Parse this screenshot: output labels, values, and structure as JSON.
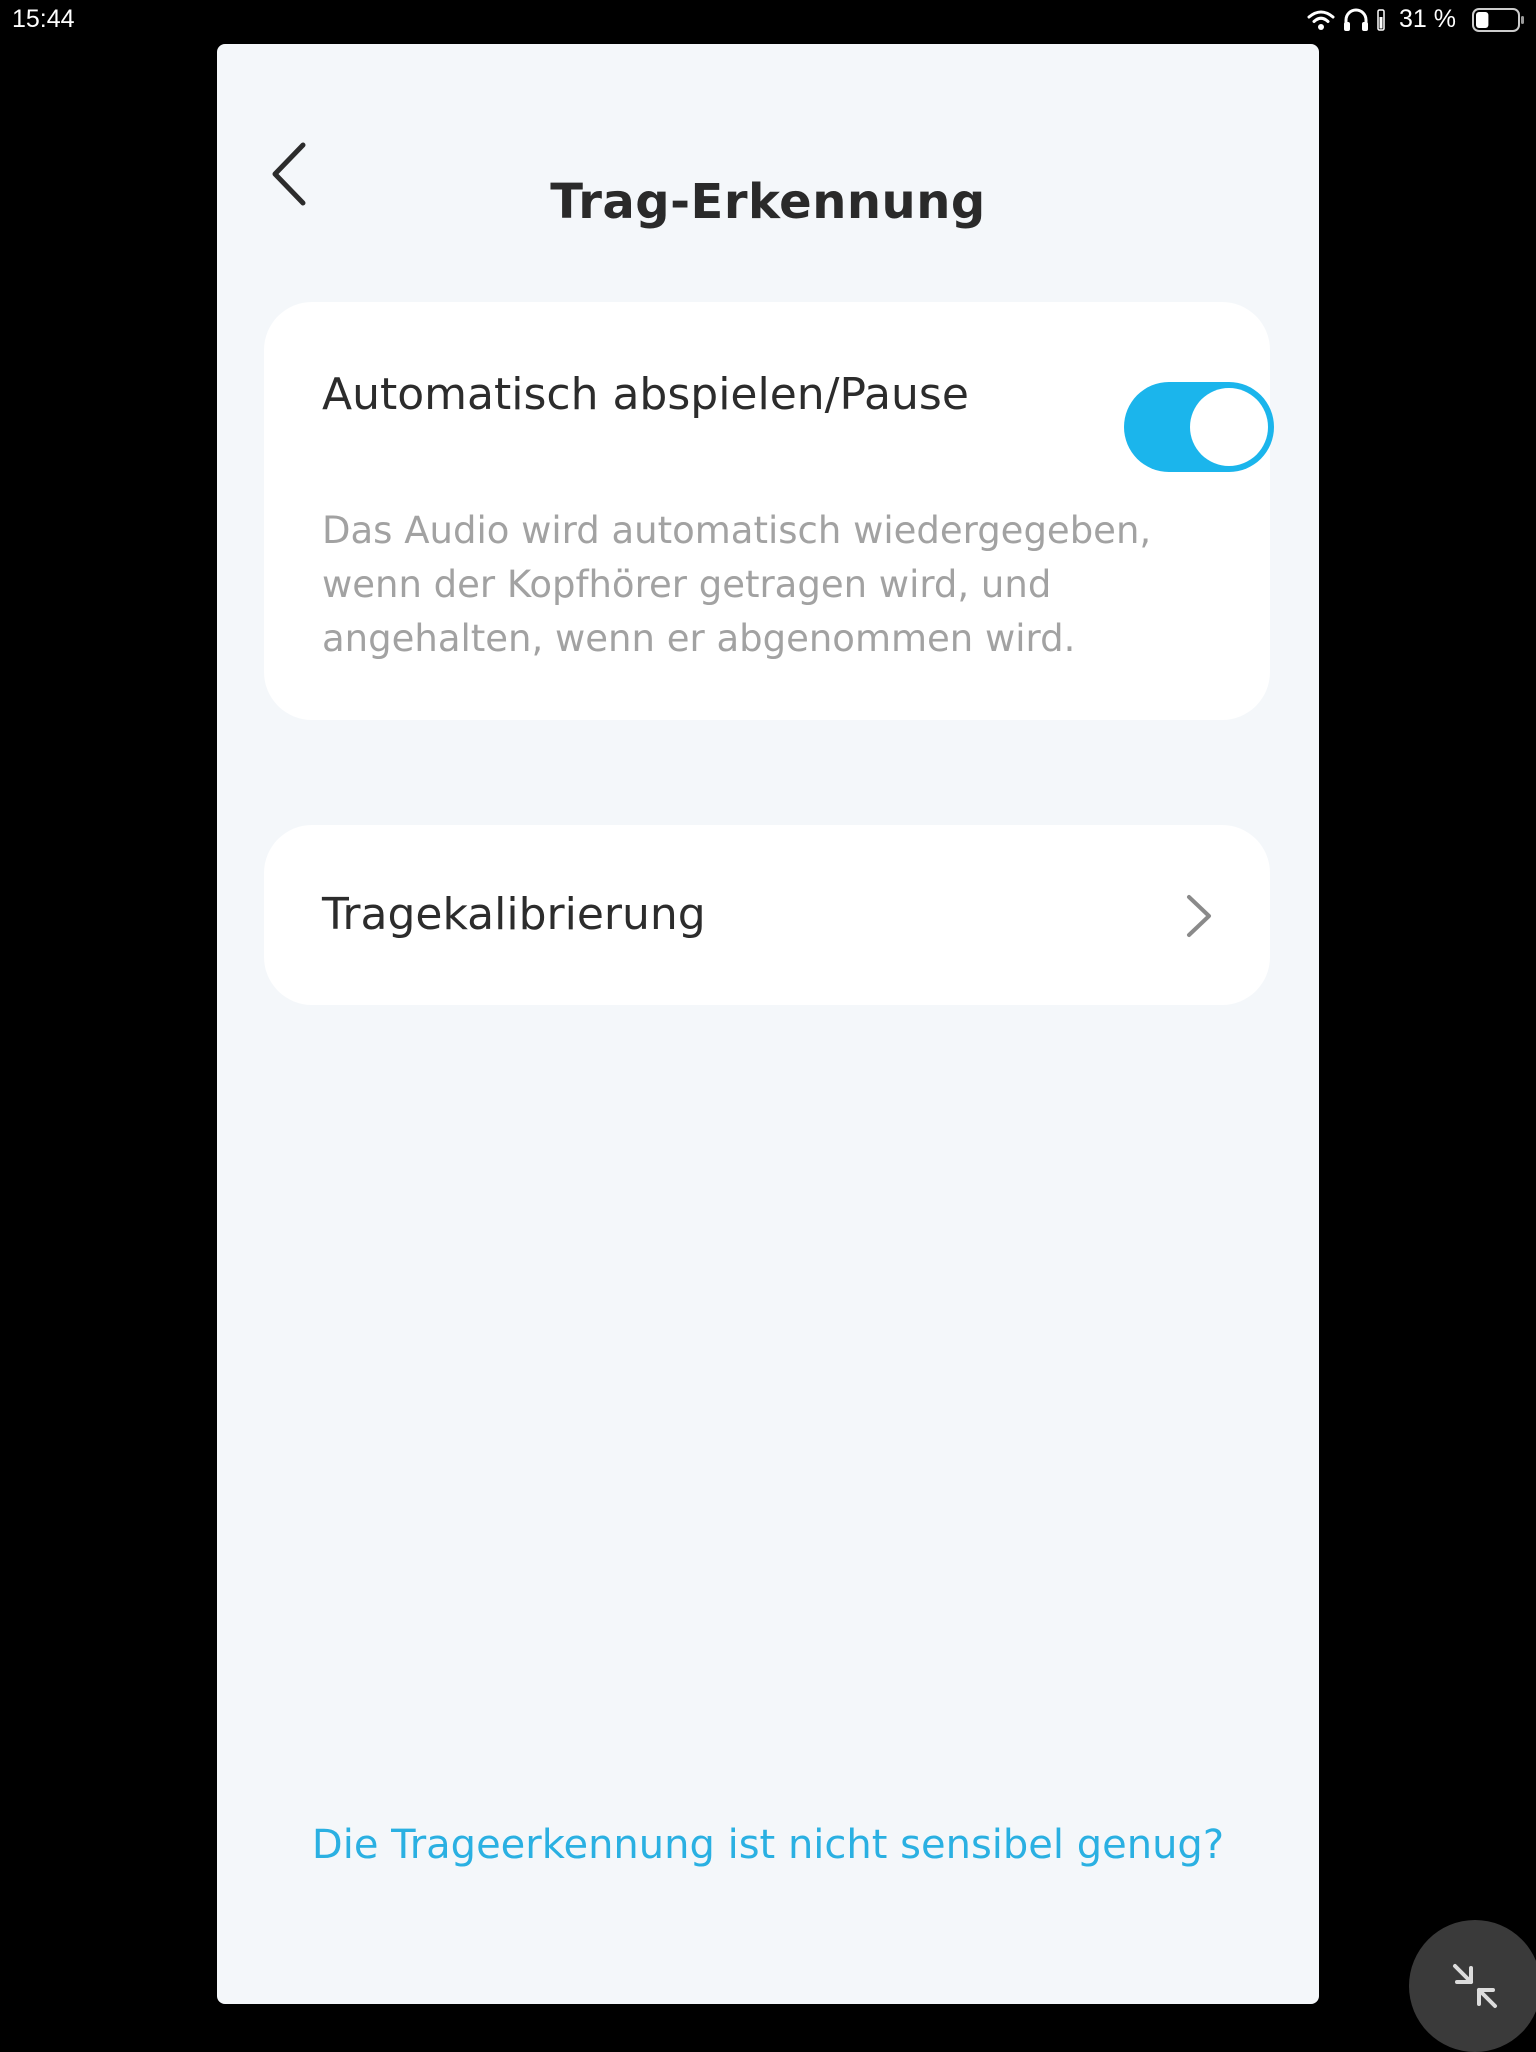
{
  "status_bar": {
    "time": "15:44",
    "battery_percent": "31 %",
    "battery_level": 0.31,
    "icons": [
      "wifi-icon",
      "headphones-icon",
      "battery-icon"
    ]
  },
  "header": {
    "title": "Trag-Erkennung",
    "back_icon": "chevron-left-icon"
  },
  "autoplay_setting": {
    "title": "Automatisch abspielen/Pause",
    "description": "Das Audio wird automatisch wiedergegeben, wenn der Kopfhörer getragen wird, und angehalten, wenn er abgenommen wird.",
    "enabled": true
  },
  "calibration": {
    "label": "Tragekalibrierung",
    "icon": "chevron-right-icon"
  },
  "help_link": {
    "label": "Die Trageerkennung ist nicht sensibel genug?"
  },
  "floating_button": {
    "icon": "collapse-arrows-icon"
  },
  "colors": {
    "accent": "#1bb5ec",
    "link": "#2ab0e2",
    "background": "#f4f7fa",
    "card": "#ffffff",
    "title_text": "#2a2a2a",
    "secondary_text": "#a2a2a2"
  }
}
